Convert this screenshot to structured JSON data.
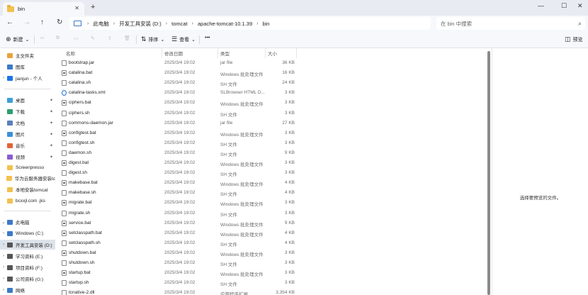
{
  "window": {
    "tab_title": "bin",
    "tab_close": "✕",
    "new_tab": "+",
    "controls": {
      "minimize": "—",
      "maximize": "☐",
      "close": "✕"
    }
  },
  "nav": {
    "back": "←",
    "forward": "→",
    "up": "↑",
    "refresh": "↻",
    "breadcrumbs": [
      "此电脑",
      "开发工具安装 (D:)",
      "tomcat",
      "apache-tomcat-10.1.39",
      "bin"
    ],
    "separator": "›",
    "search_placeholder": "在 bin 中搜索",
    "search_icon": "⌕"
  },
  "toolbar": {
    "new_label": "新建",
    "new_icon": "⊕",
    "sort_label": "排序",
    "view_label": "查看",
    "more": "•••",
    "preview_label": "预览",
    "dropdown": "⌄"
  },
  "sidebar": {
    "items": [
      {
        "label": "主文件夹",
        "icon": "home-icon",
        "chev": "",
        "pin": "",
        "color": "#e9a23b"
      },
      {
        "label": "图库",
        "icon": "gallery-icon",
        "chev": "",
        "pin": "",
        "color": "#3b79c7"
      },
      {
        "label": "jianjun - 个人",
        "icon": "cloud-icon",
        "chev": "›",
        "pin": "",
        "color": "#1a73e8"
      },
      {
        "label": "桌面",
        "icon": "desktop-icon",
        "chev": "",
        "pin": "✦",
        "color": "#3ba0d9"
      },
      {
        "label": "下载",
        "icon": "download-icon",
        "chev": "",
        "pin": "✦",
        "color": "#2f9e6e"
      },
      {
        "label": "文档",
        "icon": "document-icon",
        "chev": "",
        "pin": "✦",
        "color": "#5b7fb8"
      },
      {
        "label": "图片",
        "icon": "picture-icon",
        "chev": "",
        "pin": "✦",
        "color": "#3b8fd9"
      },
      {
        "label": "音乐",
        "icon": "music-icon",
        "chev": "",
        "pin": "✦",
        "color": "#e3623a"
      },
      {
        "label": "视频",
        "icon": "video-icon",
        "chev": "",
        "pin": "✦",
        "color": "#8b5bd1"
      },
      {
        "label": "Screenpresso",
        "icon": "folder-icon",
        "chev": "",
        "pin": "",
        "color": "#f2c14e"
      },
      {
        "label": "华为云服务器安装tc",
        "icon": "folder-icon",
        "chev": "",
        "pin": "",
        "color": "#f2c14e"
      },
      {
        "label": "本地安装tomcat",
        "icon": "folder-icon",
        "chev": "",
        "pin": "",
        "color": "#f2c14e"
      },
      {
        "label": "bcxxjl.com .jks",
        "icon": "folder-icon",
        "chev": "",
        "pin": "",
        "color": "#f2c14e"
      },
      {
        "label": "此电脑",
        "icon": "pc-icon",
        "chev": "⌄",
        "pin": "",
        "color": "#3b79c7"
      },
      {
        "label": "Windows (C:)",
        "icon": "drive-icon",
        "chev": "›",
        "pin": "",
        "color": "#3b79c7"
      },
      {
        "label": "开发工具安装 (D:)",
        "icon": "drive-icon",
        "chev": "›",
        "pin": "",
        "color": "#555555"
      },
      {
        "label": "学习资料 (E:)",
        "icon": "drive-icon",
        "chev": "›",
        "pin": "",
        "color": "#555555"
      },
      {
        "label": "项目资料 (F:)",
        "icon": "drive-icon",
        "chev": "›",
        "pin": "",
        "color": "#555555"
      },
      {
        "label": "公司资料 (G:)",
        "icon": "drive-icon",
        "chev": "›",
        "pin": "",
        "color": "#555555"
      },
      {
        "label": "网络",
        "icon": "network-icon",
        "chev": "›",
        "pin": "",
        "color": "#3b79c7"
      }
    ]
  },
  "files": {
    "columns": {
      "name": "名称",
      "date": "修改日期",
      "type": "类型",
      "size": "大小"
    },
    "rows": [
      {
        "name": "bootstrap.jar",
        "date": "2025/3/4 19:02",
        "type": "jar file",
        "size": "36 KB",
        "kind": "jar"
      },
      {
        "name": "catalina.bat",
        "date": "2025/3/4 19:02",
        "type": "Windows 批处理文件",
        "size": "16 KB",
        "kind": "bat"
      },
      {
        "name": "catalina.sh",
        "date": "2025/3/4 19:02",
        "type": "SH 文件",
        "size": "24 KB",
        "kind": "sh"
      },
      {
        "name": "catalina-tasks.xml",
        "date": "2025/3/4 19:02",
        "type": "SLBrowser HTML D...",
        "size": "3 KB",
        "kind": "xml"
      },
      {
        "name": "ciphers.bat",
        "date": "2025/3/4 19:02",
        "type": "Windows 批处理文件",
        "size": "3 KB",
        "kind": "bat"
      },
      {
        "name": "ciphers.sh",
        "date": "2025/3/4 19:02",
        "type": "SH 文件",
        "size": "3 KB",
        "kind": "sh"
      },
      {
        "name": "commons-daemon.jar",
        "date": "2025/3/4 19:02",
        "type": "jar file",
        "size": "27 KB",
        "kind": "jar"
      },
      {
        "name": "configtest.bat",
        "date": "2025/3/4 19:02",
        "type": "Windows 批处理文件",
        "size": "3 KB",
        "kind": "bat"
      },
      {
        "name": "configtest.sh",
        "date": "2025/3/4 19:02",
        "type": "SH 文件",
        "size": "3 KB",
        "kind": "sh"
      },
      {
        "name": "daemon.sh",
        "date": "2025/3/4 19:02",
        "type": "SH 文件",
        "size": "9 KB",
        "kind": "sh"
      },
      {
        "name": "digest.bat",
        "date": "2025/3/4 19:02",
        "type": "Windows 批处理文件",
        "size": "3 KB",
        "kind": "bat"
      },
      {
        "name": "digest.sh",
        "date": "2025/3/4 19:02",
        "type": "SH 文件",
        "size": "3 KB",
        "kind": "sh"
      },
      {
        "name": "makebase.bat",
        "date": "2025/3/4 19:02",
        "type": "Windows 批处理文件",
        "size": "4 KB",
        "kind": "bat"
      },
      {
        "name": "makebase.sh",
        "date": "2025/3/4 19:02",
        "type": "SH 文件",
        "size": "4 KB",
        "kind": "sh"
      },
      {
        "name": "migrate.bat",
        "date": "2025/3/4 19:02",
        "type": "Windows 批处理文件",
        "size": "3 KB",
        "kind": "bat"
      },
      {
        "name": "migrate.sh",
        "date": "2025/3/4 19:02",
        "type": "SH 文件",
        "size": "3 KB",
        "kind": "sh"
      },
      {
        "name": "service.bat",
        "date": "2025/3/4 19:02",
        "type": "Windows 批处理文件",
        "size": "9 KB",
        "kind": "bat"
      },
      {
        "name": "setclasspath.bat",
        "date": "2025/3/4 19:02",
        "type": "Windows 批处理文件",
        "size": "4 KB",
        "kind": "bat"
      },
      {
        "name": "setclasspath.sh",
        "date": "2025/3/4 19:02",
        "type": "SH 文件",
        "size": "4 KB",
        "kind": "sh"
      },
      {
        "name": "shutdown.bat",
        "date": "2025/3/4 19:02",
        "type": "Windows 批处理文件",
        "size": "3 KB",
        "kind": "bat"
      },
      {
        "name": "shutdown.sh",
        "date": "2025/3/4 19:02",
        "type": "SH 文件",
        "size": "3 KB",
        "kind": "sh"
      },
      {
        "name": "startup.bat",
        "date": "2025/3/4 19:02",
        "type": "Windows 批处理文件",
        "size": "3 KB",
        "kind": "bat"
      },
      {
        "name": "startup.sh",
        "date": "2025/3/4 19:02",
        "type": "SH 文件",
        "size": "3 KB",
        "kind": "sh"
      },
      {
        "name": "tcnative-2.dll",
        "date": "2025/3/4 19:02",
        "type": "应用程序扩展",
        "size": "3,354 KB",
        "kind": "dll"
      }
    ]
  },
  "preview": {
    "message": "选择要预览的文件。"
  }
}
